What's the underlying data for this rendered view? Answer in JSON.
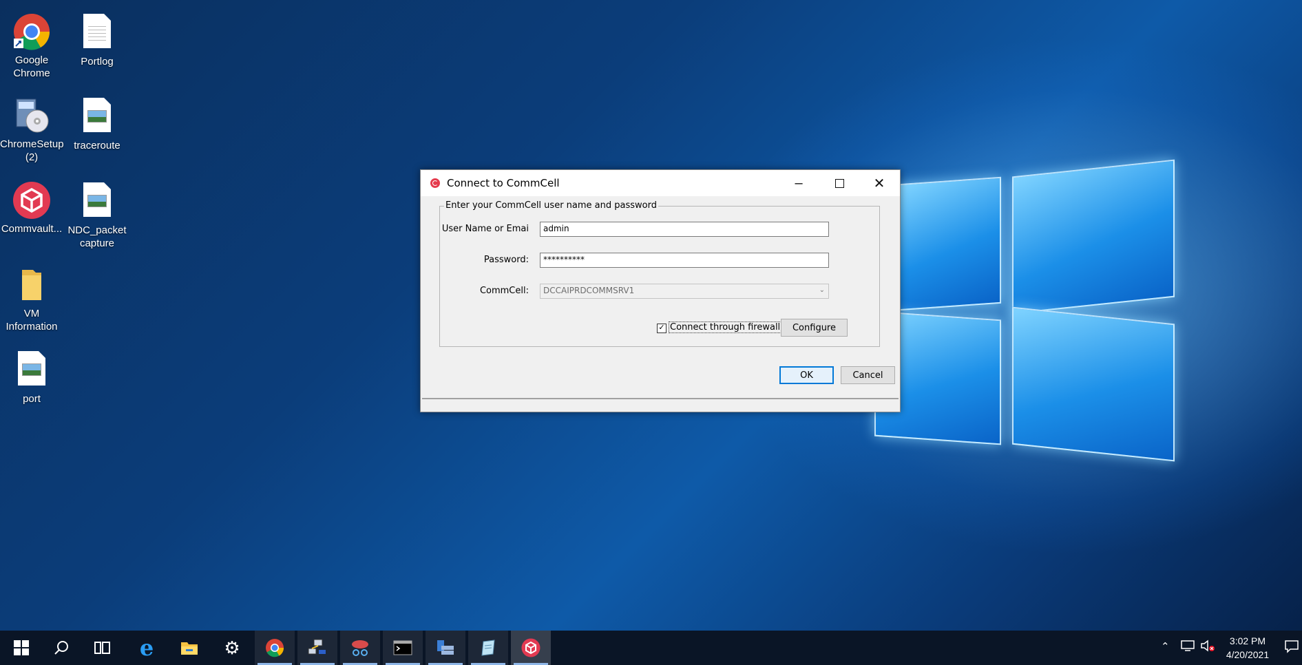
{
  "desktop": {
    "icons": [
      {
        "label": "Google Chrome"
      },
      {
        "label": "Portlog"
      },
      {
        "label": "ChromeSetup (2)"
      },
      {
        "label": "traceroute"
      },
      {
        "label": "Commvault..."
      },
      {
        "label": "NDC_packet capture"
      },
      {
        "label": "VM Information"
      },
      {
        "label": "port"
      }
    ]
  },
  "dialog": {
    "title": "Connect to CommCell",
    "group_title": "Enter your CommCell user name and password",
    "username_label": "User Name or Emai",
    "username_value": "admin",
    "password_label": "Password:",
    "password_value": "**********",
    "commcell_label": "CommCell:",
    "commcell_value": "DCCAIPRDCOMMSRV1",
    "firewall_label": "Connect through firewall",
    "firewall_checked": true,
    "configure_label": "Configure",
    "ok_label": "OK",
    "cancel_label": "Cancel"
  },
  "taskbar": {
    "clock_time": "3:02 PM",
    "clock_date": "4/20/2021",
    "items": [
      "start-icon",
      "search-icon",
      "task-view-icon",
      "internet-explorer-icon",
      "file-explorer-icon",
      "settings-icon",
      "chrome-icon",
      "network-tool-icon",
      "snipping-tool-icon",
      "command-prompt-icon",
      "server-manager-icon",
      "notepad-icon",
      "commvault-icon"
    ]
  },
  "colors": {
    "accent": "#0078d7",
    "commvault_red": "#e53b4d",
    "taskbar_bg": "#0a1526"
  }
}
